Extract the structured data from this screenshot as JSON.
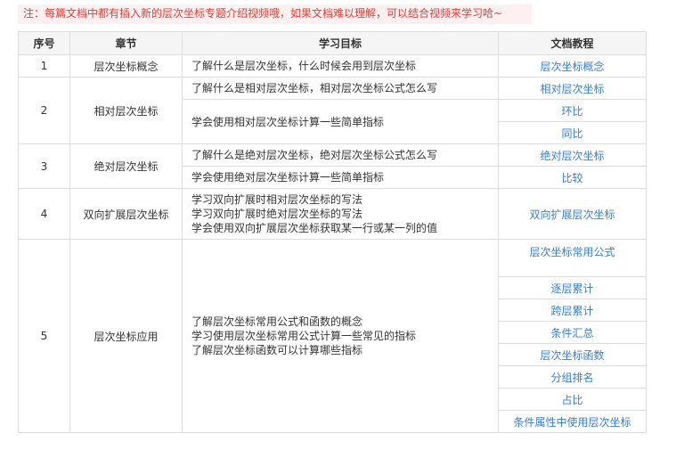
{
  "note": "注：每篇文档中都有插入新的层次坐标专题介绍视频哦，如果文档难以理解，可以结合视频来学习哈~",
  "table": {
    "headers": [
      "序号",
      "章节",
      "学习目标",
      "文档教程"
    ],
    "rows": [
      {
        "num": "1",
        "chapter": "层次坐标概念",
        "goals": [
          "了解什么是层次坐标，什么时候会用到层次坐标"
        ],
        "docs": [
          "层次坐标概念"
        ]
      },
      {
        "num": "2",
        "chapter": "相对层次坐标",
        "goals": [
          "了解什么是相对层次坐标，相对层次坐标公式怎么写",
          "学会使用相对层次坐标计算一些简单指标"
        ],
        "docs": [
          "相对层次坐标",
          "环比",
          "同比"
        ]
      },
      {
        "num": "3",
        "chapter": "绝对层次坐标",
        "goals": [
          "了解什么是绝对层次坐标，绝对层次坐标公式怎么写",
          "学会使用绝对层次坐标计算一些简单指标"
        ],
        "docs": [
          "绝对层次坐标",
          "比较"
        ]
      },
      {
        "num": "4",
        "chapter": "双向扩展层次坐标",
        "goals": [
          "学习双向扩展时相对层次坐标的写法",
          "学习双向扩展时绝对层次坐标的写法",
          "学会使用双向扩展层次坐标获取某一行或某一列的值"
        ],
        "docs": [
          "双向扩展层次坐标"
        ]
      },
      {
        "num": "5",
        "chapter": "层次坐标应用",
        "goals": [
          "了解层次坐标常用公式和函数的概念",
          "学习使用层次坐标常用公式计算一些常见的指标",
          "了解层次坐标函数可以计算哪些指标"
        ],
        "docs": [
          "层次坐标常用公式",
          "逐层累计",
          "跨层累计",
          "条件汇总",
          "层次坐标函数",
          "分组排名",
          "占比",
          "条件属性中使用层次坐标"
        ]
      }
    ]
  }
}
